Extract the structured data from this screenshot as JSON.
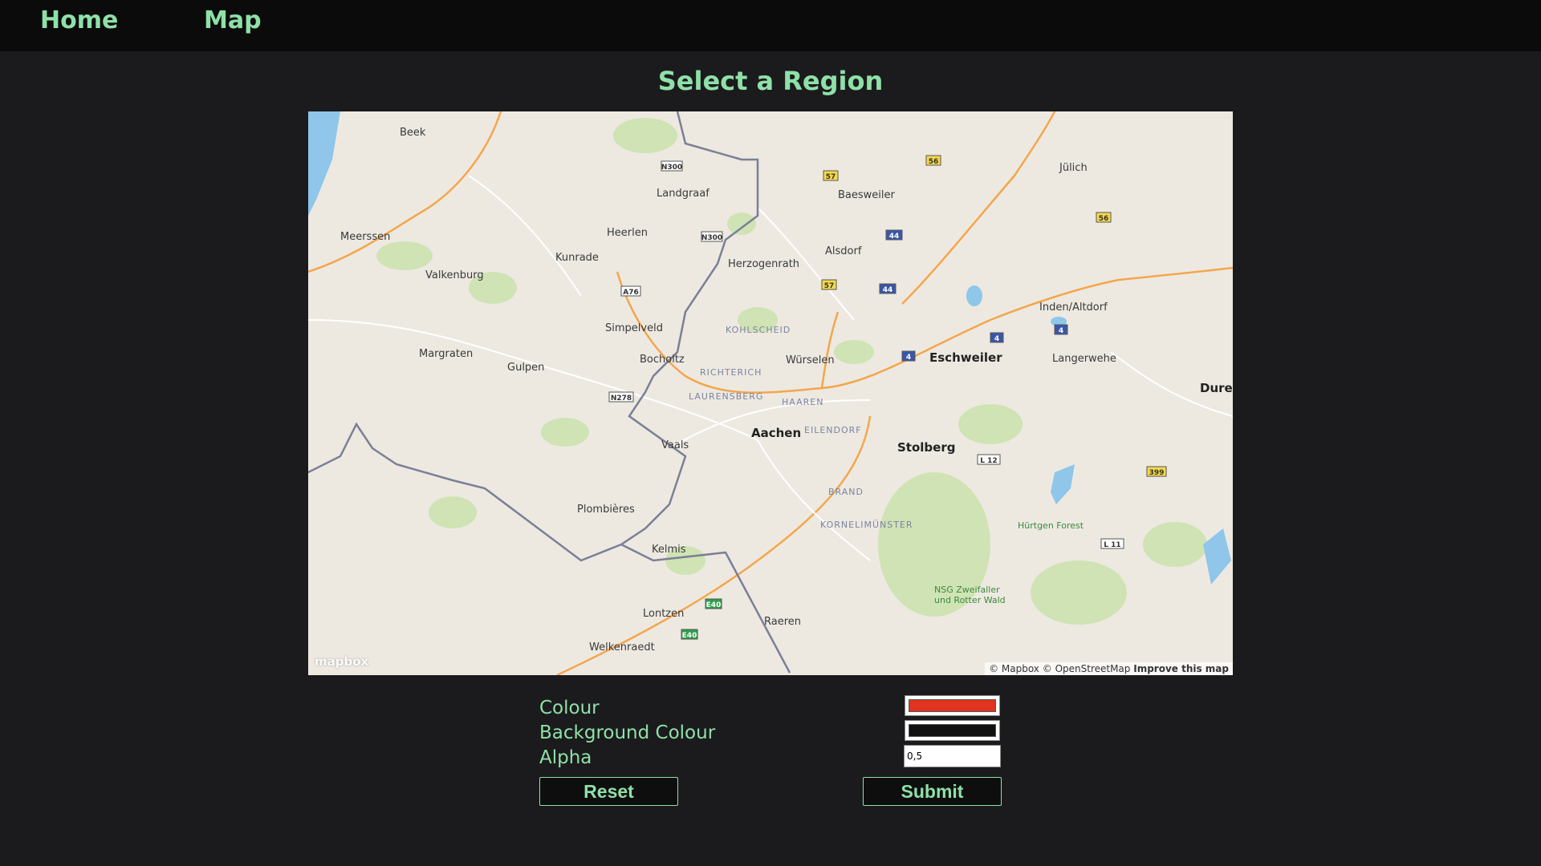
{
  "nav": {
    "home_label": "Home",
    "map_label": "Map"
  },
  "page": {
    "title": "Select a Region"
  },
  "map": {
    "logo": "mapbox",
    "attribution_mapbox": "© Mapbox",
    "attribution_osm": "© OpenStreetMap",
    "improve_label": "Improve this map",
    "places": {
      "aachen": "Aachen",
      "eschweiler": "Eschweiler",
      "stolberg": "Stolberg",
      "heerlen": "Heerlen",
      "wurselen": "Würselen",
      "herzogenrath": "Herzogenrath",
      "alsdorf": "Alsdorf",
      "baesweiler": "Baesweiler",
      "kerkrade": "Kunrade",
      "landgraaf": "Landgraaf",
      "valkenburg": "Valkenburg",
      "vaals": "Vaals",
      "kelmis": "Kelmis",
      "gulpen": "Gulpen",
      "margraten": "Margraten",
      "simpelveld": "Simpelveld",
      "bocholtz": "Bocholtz",
      "meerssen": "Meerssen",
      "beek": "Beek",
      "julich": "Jülich",
      "inden": "Inden/Altdorf",
      "langerwehe": "Langerwehe",
      "duren": "Duren",
      "plombieres": "Plombières",
      "raeren": "Raeren",
      "lontzen": "Lontzen",
      "welkenraedt": "Welkenraedt",
      "hurtgen_forest": "Hürtgen Forest",
      "nsg": "NSG Zweifaller und Rotter Wald",
      "laurensberg": "LAURENSBERG",
      "richterich": "RICHTERICH",
      "kohlscheid": "KOHLSCHEID",
      "brand": "BRAND",
      "kornelimunster": "KORNELIMÜNSTER",
      "haaren": "HAAREN",
      "eilendorf": "EILENDORF"
    }
  },
  "form": {
    "colour_label": "Colour",
    "background_colour_label": "Background Colour",
    "alpha_label": "Alpha",
    "colour_value": "#e03320",
    "background_colour_value": "#111111",
    "alpha_value": "0,5",
    "reset_label": "Reset",
    "submit_label": "Submit"
  },
  "colors": {
    "accent": "#8fe0a8",
    "background": "#1b1b1d",
    "navbar": "#0b0b0b"
  }
}
